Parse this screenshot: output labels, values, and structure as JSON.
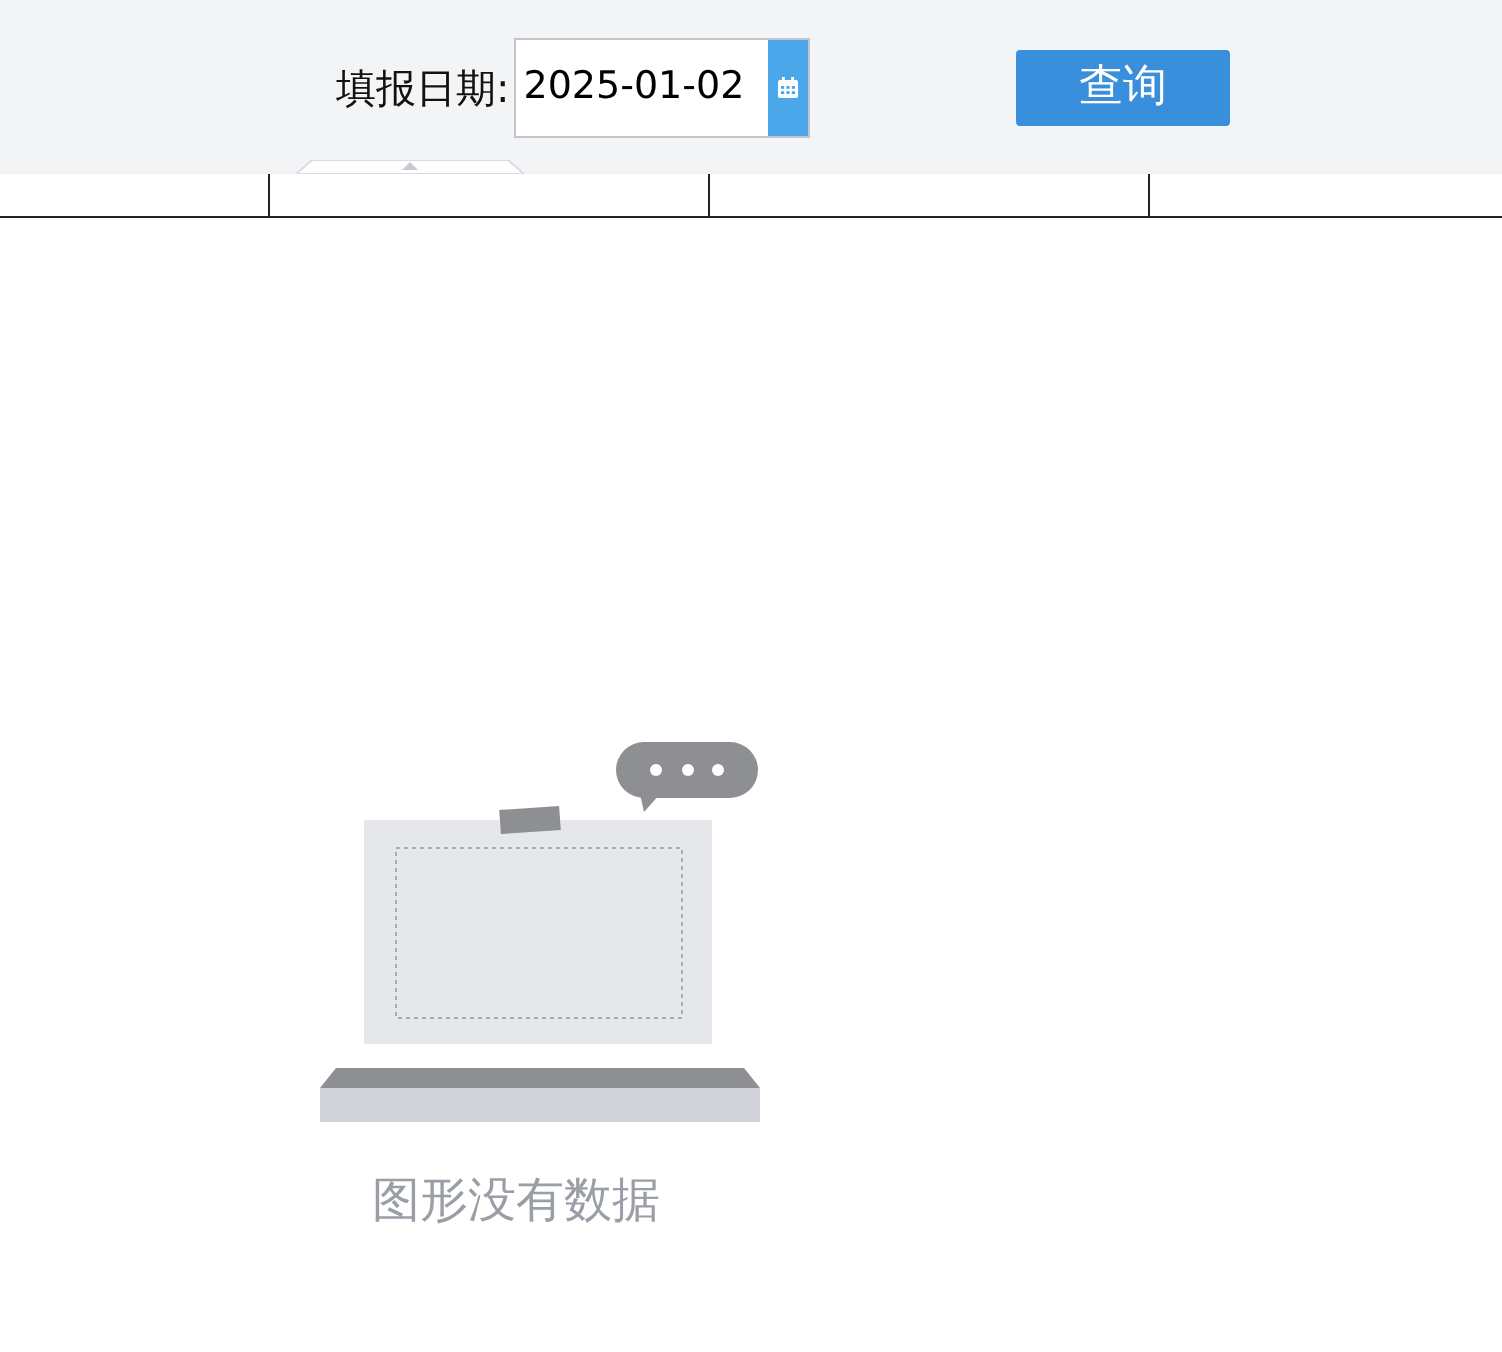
{
  "filter": {
    "label": "填报日期:",
    "date": "2025-01-02",
    "button": "查询"
  },
  "chart": {
    "empty_text": "图形没有数据"
  }
}
